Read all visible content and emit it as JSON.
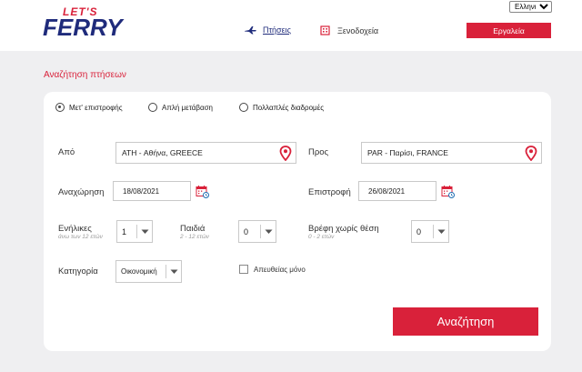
{
  "brand": {
    "top": "LET'S",
    "main": "FERRY"
  },
  "language": {
    "selected": "Ελληνικά"
  },
  "nav": {
    "flights_label": "Πτήσεις",
    "hotels_label": "Ξενοδοχεία",
    "tools_label": "Εργαλεία"
  },
  "section_title": "Αναζήτηση πτήσεων",
  "trip_types": {
    "round_trip": "Μετ' επιστροφής",
    "one_way": "Απλή μετάβαση",
    "multi_city": "Πολλαπλές διαδρομές"
  },
  "from": {
    "label": "Από",
    "value": "ATH - Αθήνα, GREECE"
  },
  "to": {
    "label": "Προς",
    "value": "PAR - Παρίσι, FRANCE"
  },
  "departure": {
    "label": "Αναχώρηση",
    "value": "18/08/2021"
  },
  "return": {
    "label": "Επιστροφή",
    "value": "26/08/2021"
  },
  "adults": {
    "label": "Ενήλικες",
    "sub": "άνω των 12 ετών",
    "value": "1"
  },
  "children": {
    "label": "Παιδιά",
    "sub": "2 - 12 ετών",
    "value": "0"
  },
  "infants": {
    "label": "Βρέφη χωρίς θέση",
    "sub": "0 - 2 ετών",
    "value": "0"
  },
  "category": {
    "label": "Κατηγορία",
    "value": "Οικονομική"
  },
  "direct_only": {
    "label": "Απευθείας μόνο"
  },
  "search_button": "Αναζήτηση",
  "colors": {
    "brand_red": "#d9213a",
    "brand_navy": "#1f2b7b"
  }
}
